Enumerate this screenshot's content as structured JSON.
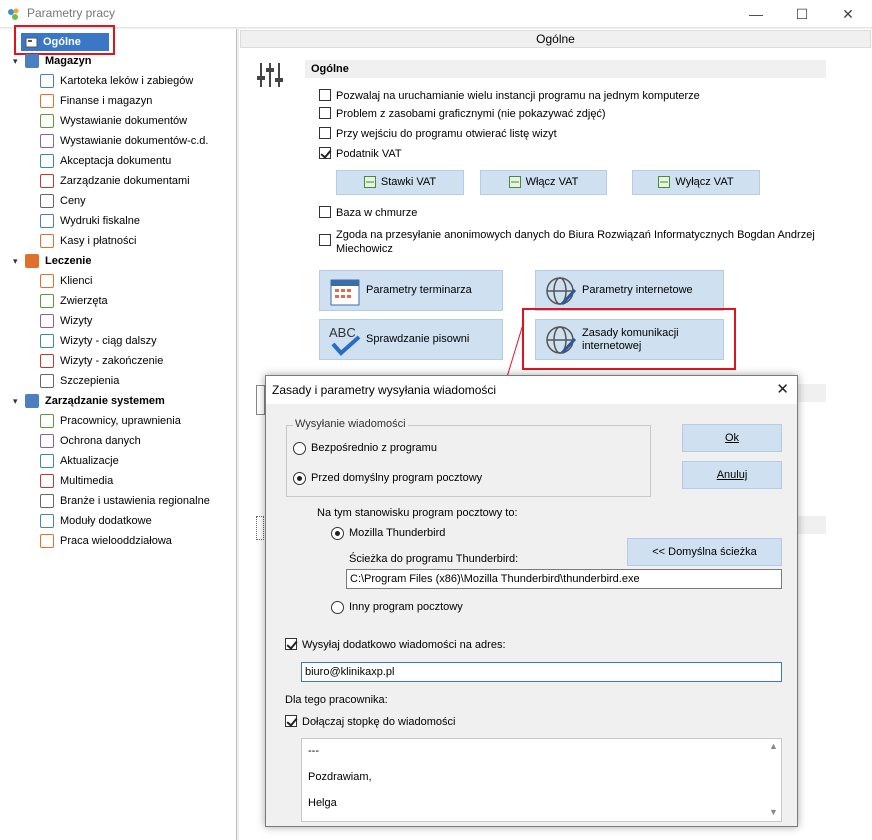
{
  "window": {
    "title": "Parametry pracy",
    "minimize_glyph": "—",
    "maximize_glyph": "☐",
    "close_glyph": "✕"
  },
  "tree": {
    "selected": "Ogólne",
    "groups": [
      {
        "label": "Magazyn",
        "items": [
          "Kartoteka leków i zabiegów",
          "Finanse i magazyn",
          "Wystawianie dokumentów",
          "Wystawianie dokumentów-c.d.",
          "Akceptacja dokumentu",
          "Zarządzanie dokumentami",
          "Ceny",
          "Wydruki fiskalne",
          "Kasy i płatności"
        ]
      },
      {
        "label": "Leczenie",
        "items": [
          "Klienci",
          "Zwierzęta",
          "Wizyty",
          "Wizyty - ciąg dalszy",
          "Wizyty - zakończenie",
          "Szczepienia"
        ]
      },
      {
        "label": "Zarządzanie systemem",
        "items": [
          "Pracownicy, uprawnienia",
          "Ochrona danych",
          "Aktualizacje",
          "Multimedia",
          "Branże i ustawienia regionalne",
          "Moduły dodatkowe",
          "Praca wielooddziałowa"
        ]
      }
    ]
  },
  "panel": {
    "tab_label": "Ogólne",
    "section_title": "Ogólne",
    "checkboxes": [
      {
        "label": "Pozwalaj na uruchamianie wielu instancji programu na jednym komputerze",
        "checked": false
      },
      {
        "label": "Problem z zasobami graficznymi (nie pokazywać zdjęć)",
        "checked": false
      },
      {
        "label": "Przy wejściu do programu otwierać listę wizyt",
        "checked": false
      },
      {
        "label": "Podatnik VAT",
        "checked": true
      }
    ],
    "vat_buttons": [
      "Stawki VAT",
      "Włącz VAT",
      "Wyłącz VAT"
    ],
    "cloud_checkbox": {
      "label": "Baza w chmurze",
      "checked": false
    },
    "consent_checkbox": {
      "label": "Zgoda na przesyłanie anonimowych danych do Biura Rozwiązań Informatycznych Bogdan Andrzej Miechowicz",
      "checked": false
    },
    "big_buttons": [
      {
        "label": "Parametry terminarza",
        "icon": "calendar-icon"
      },
      {
        "label": "Parametry internetowe",
        "icon": "globe-pen-icon"
      },
      {
        "label": "Sprawdzanie pisowni",
        "icon": "spellcheck-icon"
      },
      {
        "label": "Zasady komunikacji internetowej",
        "icon": "globe-pen-icon"
      }
    ]
  },
  "dialog": {
    "title": "Zasady i parametry wysyłania wiadomości",
    "send_group_title": "Wysyłanie wiadomości",
    "radio_direct": "Bezpośrednio z programu",
    "radio_default_client": "Przed domyślny program pocztowy",
    "ok_label": "Ok",
    "cancel_label": "Anuluj",
    "station_label": "Na tym stanowisku program pocztowy to:",
    "radio_thunderbird": "Mozilla Thunderbird",
    "default_path_button": "<< Domyślna ścieżka",
    "path_label": "Ścieżka do programu Thunderbird:",
    "path_value": "C:\\Program Files (x86)\\Mozilla Thunderbird\\thunderbird.exe",
    "radio_other": "Inny program pocztowy",
    "extra_address_label": "Wysyłaj dodatkowo wiadomości na adres:",
    "extra_address_checked": true,
    "extra_address_value": "biuro@klinikaxp.pl",
    "employee_label": "Dla tego pracownika:",
    "footer_label": "Dołączaj stopkę do wiadomości",
    "footer_checked": true,
    "footer_lines": [
      "---",
      "Pozdrawiam,",
      "Helga"
    ]
  },
  "colors": {
    "selection": "#3b77c7",
    "button_fill": "#cfe0f1",
    "highlight_rect": "#e0141e"
  }
}
